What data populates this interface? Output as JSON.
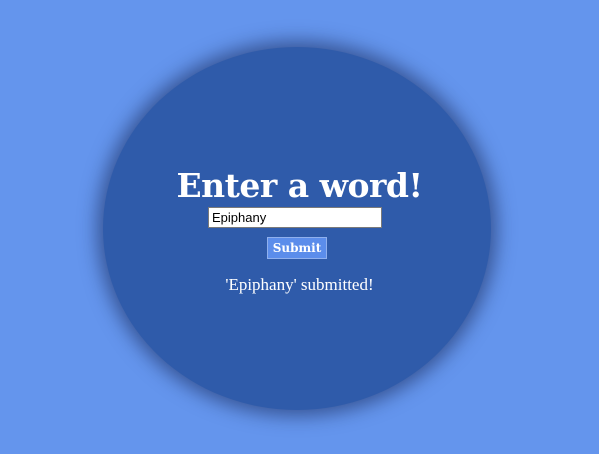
{
  "colors": {
    "background": "#6495ED",
    "circle": "#2F5BAA",
    "button": "#5B8DEB",
    "text": "#FFFFFF"
  },
  "form": {
    "title": "Enter a word!",
    "input_value": "Epiphany",
    "submit_label": "Submit",
    "status_message": "'Epiphany' submitted!"
  }
}
